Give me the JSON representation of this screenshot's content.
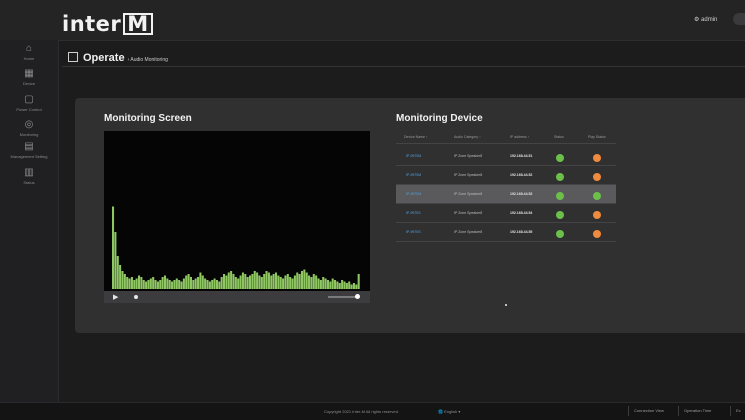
{
  "brand": {
    "logo_main": "inter",
    "logo_box": "M"
  },
  "user": {
    "label": "⚙ admin"
  },
  "sidebar": {
    "items": [
      {
        "label": "Home",
        "icon": "home-icon",
        "glyph": "⌂"
      },
      {
        "label": "Device",
        "icon": "device-icon",
        "glyph": "▦"
      },
      {
        "label": "Power Control",
        "icon": "power-icon",
        "glyph": "▢"
      },
      {
        "label": "Monitoring",
        "icon": "monitor-icon",
        "glyph": "◎"
      },
      {
        "label": "Management Setting",
        "icon": "settings-icon",
        "glyph": "▤"
      },
      {
        "label": "Status",
        "icon": "status-icon",
        "glyph": "▥"
      }
    ]
  },
  "breadcrumb": {
    "title": "Operate",
    "sub": "› Audio Monitoring"
  },
  "monitoring_screen": {
    "title": "Monitoring Screen",
    "play_glyph": "▶"
  },
  "monitoring_device": {
    "title": "Monitoring Device",
    "columns": [
      "Device Name ↑",
      "Audio Category ↑",
      "IP address ↑",
      "Status",
      "Play Status"
    ],
    "rows": [
      {
        "name": "IP-9970M",
        "stream": "IP Zone Speaker8",
        "ip": "192.168.44.51",
        "status_color": "#6cc04a",
        "play_color": "#f08a3c",
        "selected": false
      },
      {
        "name": "IP-9970M",
        "stream": "IP Zone Speaker8",
        "ip": "192.168.44.52",
        "status_color": "#6cc04a",
        "play_color": "#f08a3c",
        "selected": false
      },
      {
        "name": "IP-9970M",
        "stream": "IP Zone Speaker8",
        "ip": "192.168.44.53",
        "status_color": "#6cc04a",
        "play_color": "#6cc04a",
        "selected": true
      },
      {
        "name": "IP-9970S",
        "stream": "IP Zone Speaker8",
        "ip": "192.168.44.54",
        "status_color": "#6cc04a",
        "play_color": "#f08a3c",
        "selected": false
      },
      {
        "name": "IP-9970S",
        "stream": "IP Zone Speaker8",
        "ip": "192.168.44.55",
        "status_color": "#6cc04a",
        "play_color": "#f08a3c",
        "selected": false
      }
    ]
  },
  "spectrum": {
    "bar_color": "#8fc862",
    "levels": [
      0.55,
      0.38,
      0.22,
      0.16,
      0.12,
      0.1,
      0.08,
      0.07,
      0.08,
      0.06,
      0.07,
      0.09,
      0.08,
      0.06,
      0.05,
      0.06,
      0.07,
      0.08,
      0.06,
      0.05,
      0.06,
      0.08,
      0.09,
      0.07,
      0.06,
      0.05,
      0.06,
      0.07,
      0.06,
      0.05,
      0.07,
      0.09,
      0.1,
      0.08,
      0.06,
      0.07,
      0.08,
      0.11,
      0.09,
      0.07,
      0.06,
      0.05,
      0.06,
      0.07,
      0.06,
      0.05,
      0.08,
      0.1,
      0.09,
      0.11,
      0.12,
      0.1,
      0.08,
      0.07,
      0.09,
      0.11,
      0.1,
      0.08,
      0.09,
      0.1,
      0.12,
      0.11,
      0.09,
      0.08,
      0.1,
      0.12,
      0.11,
      0.09,
      0.1,
      0.11,
      0.09,
      0.08,
      0.07,
      0.09,
      0.1,
      0.08,
      0.07,
      0.09,
      0.11,
      0.1,
      0.12,
      0.13,
      0.11,
      0.09,
      0.08,
      0.1,
      0.09,
      0.07,
      0.06,
      0.08,
      0.07,
      0.06,
      0.05,
      0.07,
      0.06,
      0.05,
      0.04,
      0.06,
      0.05,
      0.04,
      0.05,
      0.03,
      0.04,
      0.03,
      0.1
    ]
  },
  "footer": {
    "copyright": "Copyright 2021 Inter-M All rights reserved.",
    "language": "🌐 English ▾",
    "buttons": [
      "Connection View",
      "Operation Time",
      "Ex"
    ]
  }
}
